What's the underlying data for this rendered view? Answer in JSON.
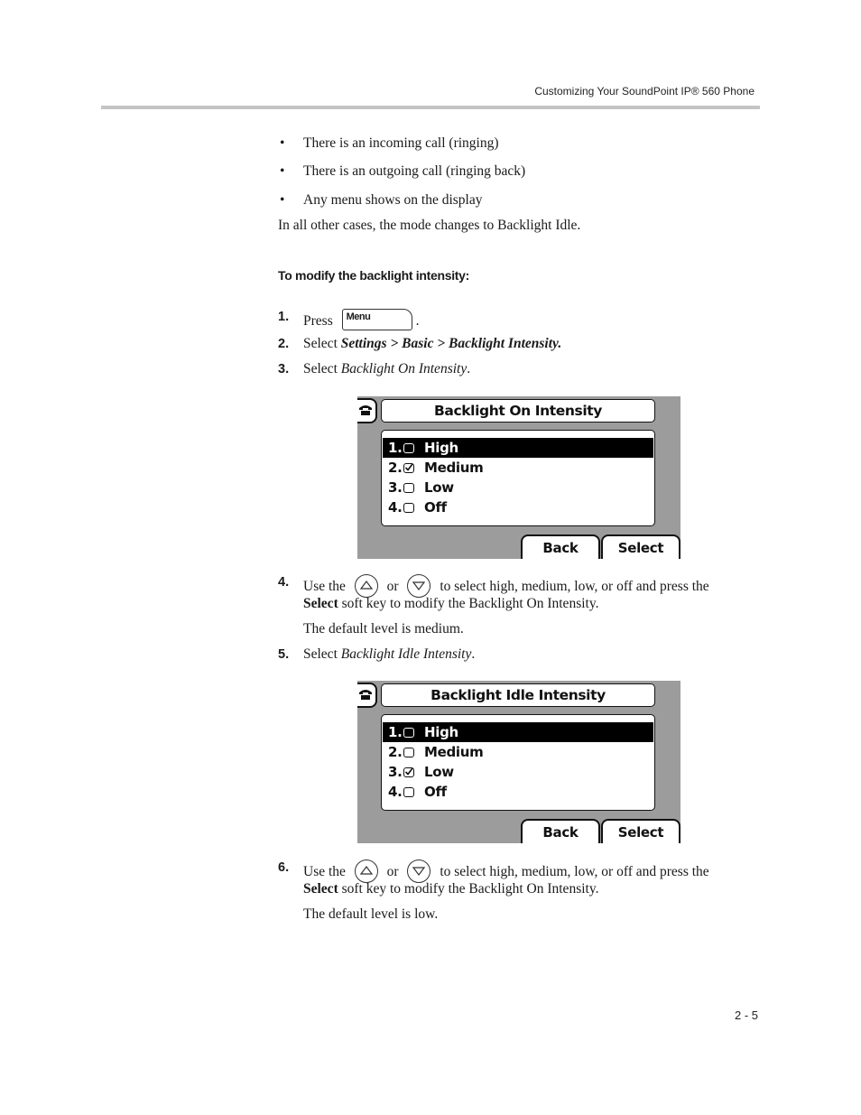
{
  "header": {
    "title": "Customizing Your SoundPoint IP® 560 Phone"
  },
  "bullets": [
    "There is an incoming call (ringing)",
    "There is an outgoing call (ringing back)",
    "Any menu shows on the display"
  ],
  "after_bullets": "In all other cases, the mode changes to Backlight Idle.",
  "procedure_title": "To modify the backlight intensity:",
  "steps": {
    "s1": {
      "num": "1.",
      "press": "Press",
      "key_label": "Menu",
      "end": "."
    },
    "s2": {
      "num": "2.",
      "select": "Select",
      "path": "Settings > Basic > Backlight Intensity."
    },
    "s3": {
      "num": "3.",
      "select": "Select",
      "item": "Backlight On Intensity",
      "end": "."
    },
    "s4": {
      "num": "4.",
      "use": "Use the",
      "or": "or",
      "rest": "to select high, medium, low, or off and press the",
      "bold": "Select",
      "line2": " soft key to modify the Backlight On Intensity.",
      "note": "The default level is medium."
    },
    "s5": {
      "num": "5.",
      "select": "Select",
      "item": "Backlight Idle Intensity",
      "end": "."
    },
    "s6": {
      "num": "6.",
      "use": "Use the",
      "or": "or",
      "rest": "to select high, medium, low, or off and press the",
      "bold": "Select",
      "line2": " soft key to modify the Backlight On Intensity.",
      "note": "The default level is low."
    }
  },
  "screens": [
    {
      "title": "Backlight On Intensity",
      "options": [
        {
          "num": "1.",
          "label": "High",
          "checked": false,
          "highlighted": true
        },
        {
          "num": "2.",
          "label": "Medium",
          "checked": true,
          "highlighted": false
        },
        {
          "num": "3.",
          "label": "Low",
          "checked": false,
          "highlighted": false
        },
        {
          "num": "4.",
          "label": "Off",
          "checked": false,
          "highlighted": false
        }
      ],
      "softkeys": [
        "Back",
        "Select"
      ]
    },
    {
      "title": "Backlight Idle Intensity",
      "options": [
        {
          "num": "1.",
          "label": "High",
          "checked": false,
          "highlighted": true
        },
        {
          "num": "2.",
          "label": "Medium",
          "checked": false,
          "highlighted": false
        },
        {
          "num": "3.",
          "label": "Low",
          "checked": true,
          "highlighted": false
        },
        {
          "num": "4.",
          "label": "Off",
          "checked": false,
          "highlighted": false
        }
      ],
      "softkeys": [
        "Back",
        "Select"
      ]
    }
  ],
  "icons": {
    "up_key": "up-arrow-key-icon",
    "down_key": "down-arrow-key-icon",
    "phone": "handset-icon"
  },
  "footer": {
    "page_number": "2 - 5"
  }
}
